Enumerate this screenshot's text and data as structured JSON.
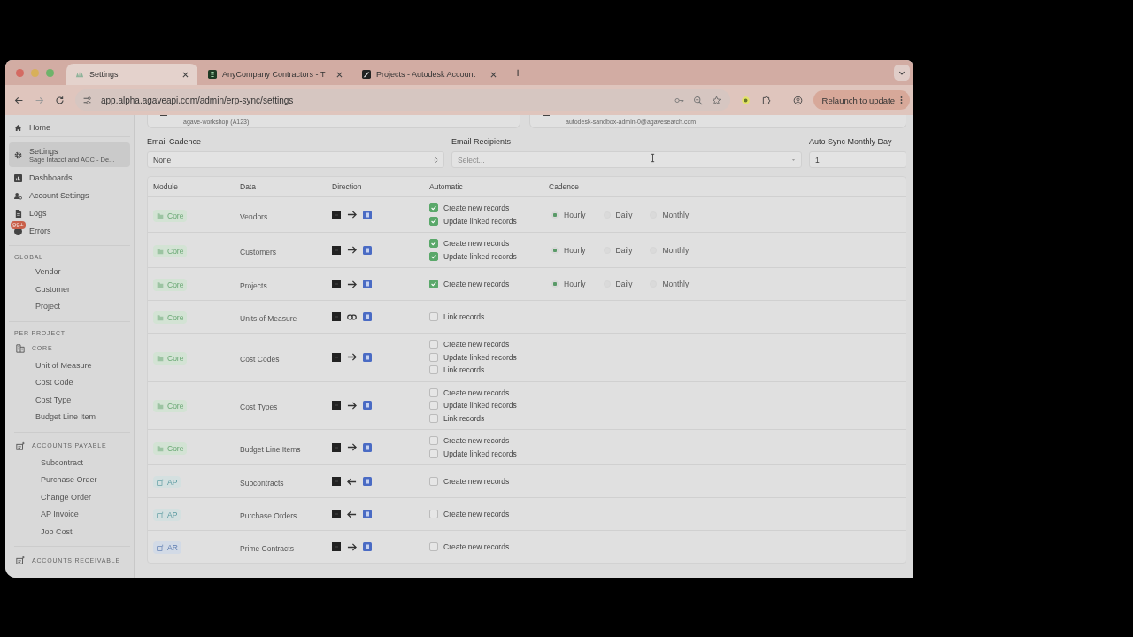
{
  "browser": {
    "tabs": [
      {
        "title": "Settings",
        "kind": "agave",
        "selected": true
      },
      {
        "title": "AnyCompany Contractors - T",
        "kind": "sheet",
        "selected": false
      },
      {
        "title": "Projects - Autodesk Account",
        "kind": "autodesk",
        "selected": false
      }
    ],
    "new_tab": "+",
    "url": "app.alpha.agaveapi.com/admin/erp-sync/settings",
    "relaunch": "Relaunch to update"
  },
  "sidebar": {
    "nav": [
      {
        "label": "Home",
        "kind": "home",
        "selected": false
      },
      {
        "label": "Settings",
        "sublabel": "Sage Intacct and ACC - De...",
        "kind": "gear",
        "selected": true
      },
      {
        "label": "Dashboards",
        "kind": "chart",
        "selected": false
      },
      {
        "label": "Account Settings",
        "kind": "user",
        "selected": false
      },
      {
        "label": "Logs",
        "kind": "doc",
        "selected": false
      },
      {
        "label": "Errors",
        "kind": "error",
        "badge": "99+",
        "selected": false
      }
    ],
    "sections": [
      {
        "heading": "GLOBAL",
        "groups": [
          {
            "items": [
              "Vendor",
              "Customer",
              "Project"
            ]
          }
        ]
      },
      {
        "heading": "PER PROJECT",
        "groups": [
          {
            "title": "CORE",
            "kind": "building",
            "items": [
              "Unit of Measure",
              "Cost Code",
              "Cost Type",
              "Budget Line Item"
            ]
          },
          {
            "title": "ACCOUNTS PAYABLE",
            "kind": "ledger",
            "items": [
              "Subcontract",
              "Purchase Order",
              "Change Order",
              "AP Invoice",
              "Job Cost"
            ]
          },
          {
            "title": "ACCOUNTS RECEIVABLE",
            "kind": "ledger"
          }
        ]
      }
    ]
  },
  "connections": [
    "agave-workshop (A123)",
    "autodesk-sandbox-admin-0@agavesearch.com"
  ],
  "fields": [
    {
      "label": "Email Cadence",
      "kind": "select",
      "value": "None"
    },
    {
      "label": "Email Recipients",
      "kind": "multiselect",
      "placeholder": "Select..."
    },
    {
      "label": "Auto Sync Monthly Day",
      "kind": "number",
      "value": "1"
    }
  ],
  "table": {
    "columns": [
      "Module",
      "Data",
      "Direction",
      "Automatic",
      "Cadence"
    ],
    "rows": [
      {
        "module": {
          "label": "Core",
          "kind": "core"
        },
        "data": "Vendors",
        "direction": {
          "kind": "to"
        },
        "options": [
          {
            "label": "Create new records",
            "checked": true
          },
          {
            "label": "Update linked records",
            "checked": true
          }
        ],
        "cadence": [
          {
            "label": "Hourly",
            "selected": true
          },
          {
            "label": "Daily",
            "selected": false
          },
          {
            "label": "Monthly",
            "selected": false
          }
        ]
      },
      {
        "module": {
          "label": "Core",
          "kind": "core"
        },
        "data": "Customers",
        "direction": {
          "kind": "to"
        },
        "options": [
          {
            "label": "Create new records",
            "checked": true
          },
          {
            "label": "Update linked records",
            "checked": true
          }
        ],
        "cadence": [
          {
            "label": "Hourly",
            "selected": true
          },
          {
            "label": "Daily",
            "selected": false
          },
          {
            "label": "Monthly",
            "selected": false
          }
        ]
      },
      {
        "module": {
          "label": "Core",
          "kind": "core"
        },
        "data": "Projects",
        "direction": {
          "kind": "to"
        },
        "options": [
          {
            "label": "Create new records",
            "checked": true
          }
        ],
        "cadence": [
          {
            "label": "Hourly",
            "selected": true
          },
          {
            "label": "Daily",
            "selected": false
          },
          {
            "label": "Monthly",
            "selected": false
          }
        ]
      },
      {
        "module": {
          "label": "Core",
          "kind": "core"
        },
        "data": "Units of Measure",
        "direction": {
          "kind": "link"
        },
        "options": [
          {
            "label": "Link records",
            "checked": false
          }
        ]
      },
      {
        "module": {
          "label": "Core",
          "kind": "core"
        },
        "data": "Cost Codes",
        "direction": {
          "kind": "to"
        },
        "options": [
          {
            "label": "Create new records",
            "checked": false
          },
          {
            "label": "Update linked records",
            "checked": false
          },
          {
            "label": "Link records",
            "checked": false
          }
        ]
      },
      {
        "module": {
          "label": "Core",
          "kind": "core"
        },
        "data": "Cost Types",
        "direction": {
          "kind": "to"
        },
        "options": [
          {
            "label": "Create new records",
            "checked": false
          },
          {
            "label": "Update linked records",
            "checked": false
          },
          {
            "label": "Link records",
            "checked": false
          }
        ]
      },
      {
        "module": {
          "label": "Core",
          "kind": "core"
        },
        "data": "Budget Line Items",
        "direction": {
          "kind": "to"
        },
        "options": [
          {
            "label": "Create new records",
            "checked": false
          },
          {
            "label": "Update linked records",
            "checked": false
          }
        ]
      },
      {
        "module": {
          "label": "AP",
          "kind": "ap"
        },
        "data": "Subcontracts",
        "direction": {
          "kind": "from"
        },
        "options": [
          {
            "label": "Create new records",
            "checked": false
          }
        ]
      },
      {
        "module": {
          "label": "AP",
          "kind": "ap"
        },
        "data": "Purchase Orders",
        "direction": {
          "kind": "from"
        },
        "options": [
          {
            "label": "Create new records",
            "checked": false
          }
        ]
      },
      {
        "module": {
          "label": "AR",
          "kind": "ar"
        },
        "data": "Prime Contracts",
        "direction": {
          "kind": "to"
        },
        "options": [
          {
            "label": "Create new records",
            "checked": false
          }
        ]
      }
    ]
  }
}
